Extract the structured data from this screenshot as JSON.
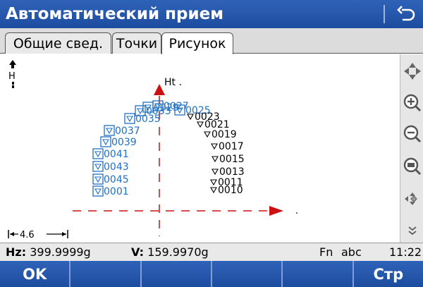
{
  "title": "Автоматический прием",
  "tabs": [
    {
      "label": "Общие свед."
    },
    {
      "label": "Точки"
    },
    {
      "label": "Рисунок"
    }
  ],
  "plot": {
    "axis_label": "Ht .",
    "scale_label": "4.6",
    "orientation_label": "H",
    "points_blue": [
      {
        "label": "0001"
      },
      {
        "label": "0045"
      },
      {
        "label": "0043"
      },
      {
        "label": "0041"
      },
      {
        "label": "0039"
      },
      {
        "label": "0037"
      },
      {
        "label": "0035"
      },
      {
        "label": "0033"
      },
      {
        "label": "0029"
      },
      {
        "label": "0027"
      },
      {
        "label": "0025"
      }
    ],
    "points_black": [
      {
        "label": "0023"
      },
      {
        "label": "0021"
      },
      {
        "label": "0019"
      },
      {
        "label": "0017"
      },
      {
        "label": "0015"
      },
      {
        "label": "0013"
      },
      {
        "label": "0011"
      },
      {
        "label": "0010"
      }
    ]
  },
  "status": {
    "hz_label": "Hz:",
    "hz_value": "399.9999g",
    "v_label": "V:",
    "v_value": "159.9970g",
    "fn": "Fn",
    "input_mode": "abc",
    "time": "11:22"
  },
  "fkeys": [
    "OK",
    "",
    "",
    "",
    "",
    "Стр"
  ],
  "colors": {
    "accent": "#1d4c9e",
    "point_blue": "#1f6fc2",
    "axis_red": "#cc1111"
  }
}
